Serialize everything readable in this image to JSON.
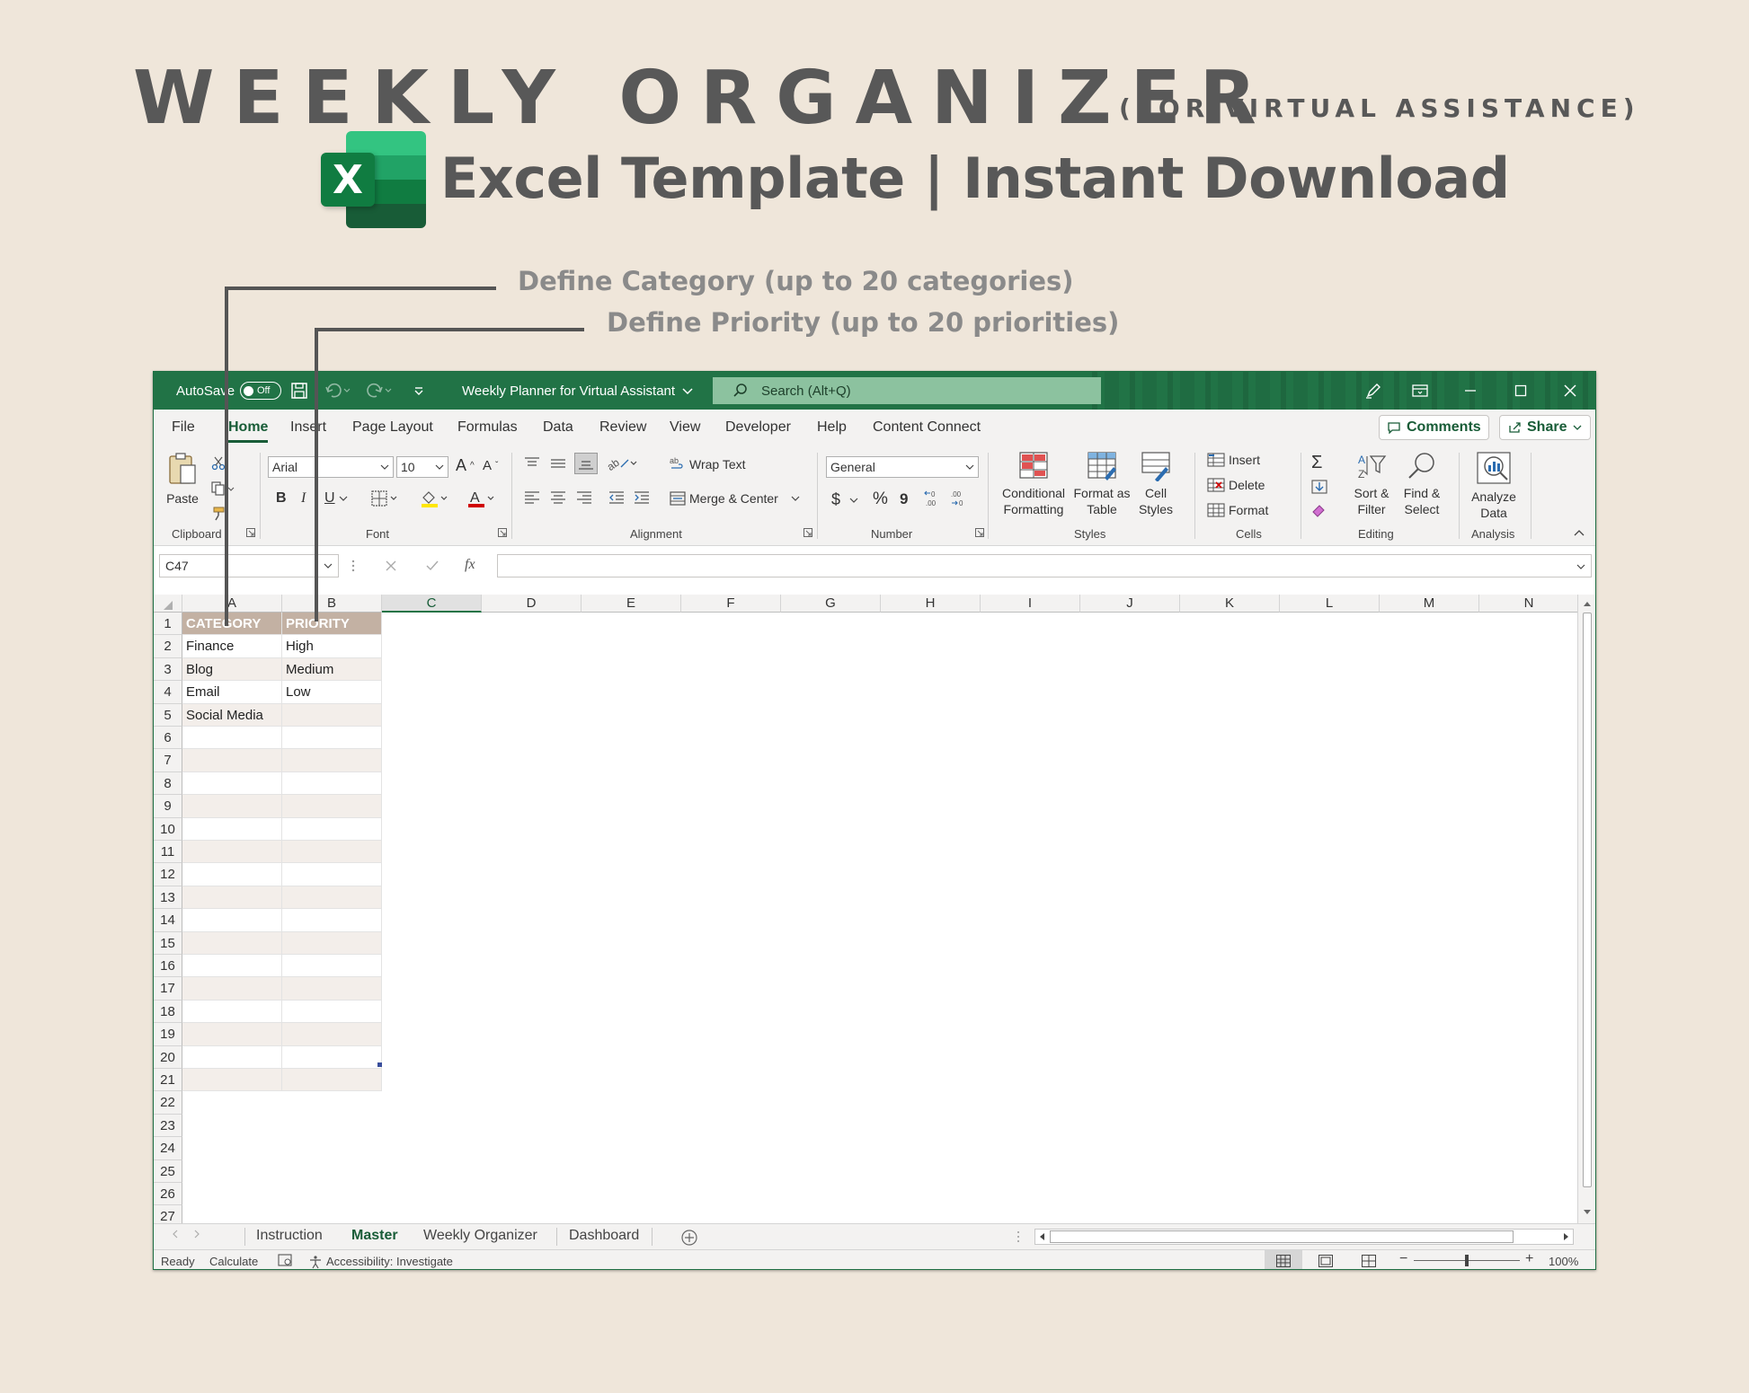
{
  "promo": {
    "headline": "WEEKLY ORGANIZER",
    "headline_sub": "(FOR VIRTUAL ASSISTANCE)",
    "logo_letter": "X",
    "tagline": "Excel Template | Instant Download",
    "callout_category": "Define Category  (up to 20 categories)",
    "callout_priority": "Define Priority  (up to 20 priorities)"
  },
  "titlebar": {
    "autosave_label": "AutoSave",
    "autosave_state": "Off",
    "document_title": "Weekly Planner for Virtual Assistant",
    "search_placeholder": "Search (Alt+Q)"
  },
  "menu": {
    "tabs": [
      "File",
      "Home",
      "Insert",
      "Page Layout",
      "Formulas",
      "Data",
      "Review",
      "View",
      "Developer",
      "Help",
      "Content Connect"
    ],
    "active_tab": "Home",
    "comments_label": "Comments",
    "share_label": "Share"
  },
  "ribbon": {
    "clipboard": {
      "paste_label": "Paste",
      "group_label": "Clipboard"
    },
    "font": {
      "font_name": "Arial",
      "font_size": "10",
      "bold": "B",
      "italic": "I",
      "underline": "U",
      "group_label": "Font"
    },
    "alignment": {
      "wrap_text": "Wrap Text",
      "merge_center": "Merge & Center",
      "group_label": "Alignment"
    },
    "number": {
      "format": "General",
      "currency": "$",
      "percent": "%",
      "comma": "9",
      "group_label": "Number"
    },
    "styles": {
      "conditional_line1": "Conditional",
      "conditional_line2": "Formatting",
      "format_table_line1": "Format as",
      "format_table_line2": "Table",
      "cell_styles_line1": "Cell",
      "cell_styles_line2": "Styles",
      "group_label": "Styles"
    },
    "cells": {
      "insert": "Insert",
      "delete": "Delete",
      "format": "Format",
      "group_label": "Cells"
    },
    "editing": {
      "sort_line1": "Sort &",
      "sort_line2": "Filter",
      "find_line1": "Find &",
      "find_line2": "Select",
      "group_label": "Editing"
    },
    "analysis": {
      "analyze_line1": "Analyze",
      "analyze_line2": "Data",
      "group_label": "Analysis"
    }
  },
  "formula_bar": {
    "name_box": "C47",
    "fx_label": "fx",
    "formula": ""
  },
  "grid": {
    "columns": [
      "A",
      "B",
      "C",
      "D",
      "E",
      "F",
      "G",
      "H",
      "I",
      "J",
      "K",
      "L",
      "M",
      "N"
    ],
    "selected_column": "C",
    "rows": [
      "1",
      "2",
      "3",
      "4",
      "5",
      "6",
      "7",
      "8",
      "9",
      "10",
      "11",
      "12",
      "13",
      "14",
      "15",
      "16",
      "17",
      "18",
      "19",
      "20",
      "21",
      "22",
      "23",
      "24",
      "25",
      "26",
      "27"
    ],
    "header": {
      "category": "CATEGORY",
      "priority": "PRIORITY"
    },
    "categories": [
      "Finance",
      "Blog",
      "Email",
      "Social Media"
    ],
    "priorities": [
      "High",
      "Medium",
      "Low"
    ]
  },
  "sheets": {
    "tabs": [
      "Instruction",
      "Master",
      "Weekly Organizer",
      "Dashboard"
    ],
    "active": "Master"
  },
  "status": {
    "ready": "Ready",
    "calculate": "Calculate",
    "accessibility": "Accessibility: Investigate",
    "zoom": "100%"
  },
  "colors": {
    "excel_green": "#217346",
    "header_fill": "#c3b1a3",
    "alt_row": "#f3eeea",
    "background": "#efe6da"
  }
}
